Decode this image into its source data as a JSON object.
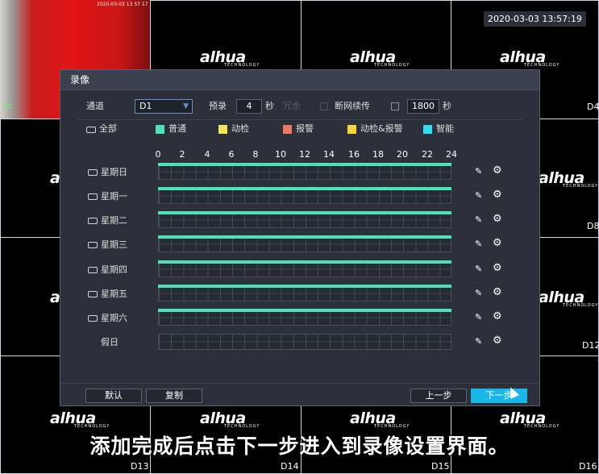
{
  "overlay": {
    "timestamp": "2020-03-03 13:57:19",
    "subtitle": "添加完成后点击下一步进入到录像设置界面。",
    "camera1_stamp": "2020-03-03 13 57 17",
    "camera1_label": "IPC",
    "logo_text": "alhua",
    "logo_sub": "TECHNOLOGY",
    "channel_labels": [
      "D4",
      "D8",
      "D12",
      "D13",
      "D14",
      "D15",
      "D16"
    ]
  },
  "dialog": {
    "title": "录像",
    "channel_label": "通道",
    "channel_value": "D1",
    "prerecord_label": "预录",
    "prerecord_value": "4",
    "prerecord_unit": "秒",
    "redundancy_label": "冗余",
    "reconnect_label": "断网续传",
    "reconnect_value": "1800",
    "reconnect_unit": "秒",
    "legend": {
      "all": "全部",
      "items": [
        {
          "label": "普通",
          "color": "#4fe2b8",
          "checked": true
        },
        {
          "label": "动检",
          "color": "#f5e35a",
          "checked": false
        },
        {
          "label": "报警",
          "color": "#f07766",
          "checked": false
        },
        {
          "label": "动检&报警",
          "color": "#f5d63a",
          "checked": false
        },
        {
          "label": "智能",
          "color": "#2fe0f0",
          "checked": false
        }
      ]
    },
    "hours": [
      "0",
      "2",
      "4",
      "6",
      "8",
      "10",
      "12",
      "14",
      "16",
      "18",
      "20",
      "22",
      "24"
    ],
    "days": [
      {
        "name": "星期日",
        "has_checkbox": true,
        "recording": "full"
      },
      {
        "name": "星期一",
        "has_checkbox": true,
        "recording": "full"
      },
      {
        "name": "星期二",
        "has_checkbox": true,
        "recording": "full"
      },
      {
        "name": "星期三",
        "has_checkbox": true,
        "recording": "full"
      },
      {
        "name": "星期四",
        "has_checkbox": true,
        "recording": "full"
      },
      {
        "name": "星期五",
        "has_checkbox": true,
        "recording": "full"
      },
      {
        "name": "星期六",
        "has_checkbox": true,
        "recording": "full"
      },
      {
        "name": "假日",
        "has_checkbox": false,
        "recording": "none"
      }
    ],
    "buttons": {
      "default": "默认",
      "copy": "复制",
      "prev": "上一步",
      "next": "下一步"
    }
  }
}
